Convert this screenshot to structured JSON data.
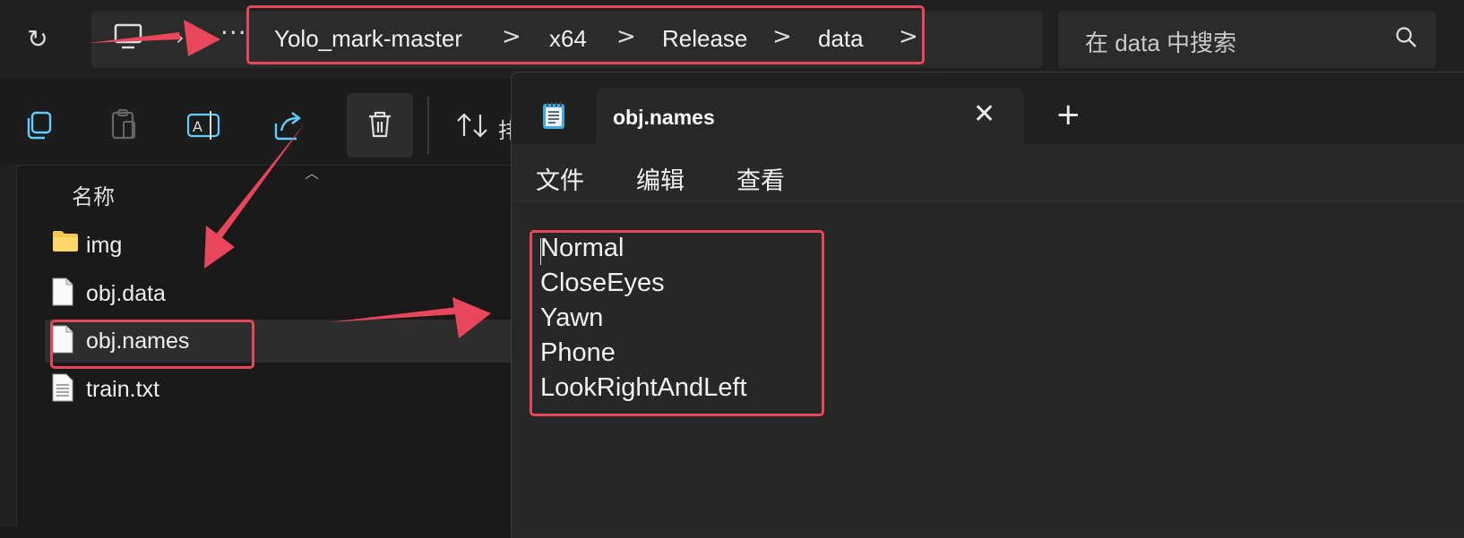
{
  "explorer": {
    "breadcrumbs": [
      "Yolo_mark-master",
      "x64",
      "Release",
      "data"
    ],
    "breadcrumb_separator": ">",
    "ellipsis": "···",
    "search_placeholder": "在 data 中搜索",
    "toolbar_truncated_label": "排",
    "column_name": "名称",
    "files": [
      {
        "name": "img",
        "icon": "folder-icon"
      },
      {
        "name": "obj.data",
        "icon": "file-icon"
      },
      {
        "name": "obj.names",
        "icon": "file-icon",
        "selected": true
      },
      {
        "name": "train.txt",
        "icon": "text-file-icon"
      }
    ]
  },
  "notepad": {
    "tab_title": "obj.names",
    "menus": [
      "文件",
      "编辑",
      "查看"
    ],
    "lines": [
      "Normal",
      "CloseEyes",
      "Yawn",
      "Phone",
      "LookRightAndLeft"
    ]
  },
  "colors": {
    "annotation": "#e8465a",
    "accent": "#60cdff",
    "folder": "#f2c94c"
  }
}
